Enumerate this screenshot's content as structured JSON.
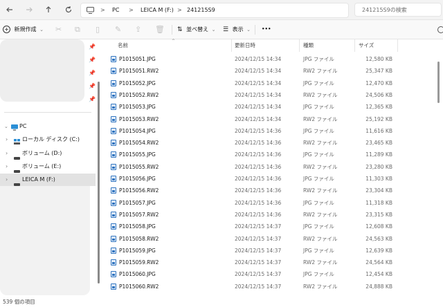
{
  "address": {
    "back_icon": "arrow-left-icon",
    "forward_icon": "arrow-right-icon",
    "up_icon": "arrow-up-icon",
    "refresh_icon": "refresh-icon",
    "path": [
      "PC",
      "LEICA M (F:)",
      "241215S9"
    ],
    "separator": ">",
    "search_placeholder": "241215S9の検索"
  },
  "toolbar": {
    "new_label": "新規作成",
    "sort_label": "並べ替え",
    "view_label": "表示",
    "more_label": "•••"
  },
  "sidebar": {
    "pc_label": "PC",
    "drives": [
      {
        "label": "ローカル ディスク (C:)",
        "icon": "local-disk-icon"
      },
      {
        "label": "ボリューム (D:)",
        "icon": "drive-icon"
      },
      {
        "label": "ボリューム (E:)",
        "icon": "drive-icon"
      },
      {
        "label": "LEICA M (F:)",
        "icon": "drive-icon",
        "selected": true
      }
    ]
  },
  "columns": {
    "name": "名前",
    "modified": "更新日時",
    "type": "種類",
    "size": "サイズ"
  },
  "files": [
    {
      "name": "P1015051.JPG",
      "date": "2024/12/15 14:34",
      "type": "JPG ファイル",
      "size": "12,580 KB"
    },
    {
      "name": "P1015051.RW2",
      "date": "2024/12/15 14:34",
      "type": "RW2 ファイル",
      "size": "25,347 KB"
    },
    {
      "name": "P1015052.JPG",
      "date": "2024/12/15 14:34",
      "type": "JPG ファイル",
      "size": "12,470 KB"
    },
    {
      "name": "P1015052.RW2",
      "date": "2024/12/15 14:34",
      "type": "RW2 ファイル",
      "size": "24,506 KB"
    },
    {
      "name": "P1015053.JPG",
      "date": "2024/12/15 14:34",
      "type": "JPG ファイル",
      "size": "12,365 KB"
    },
    {
      "name": "P1015053.RW2",
      "date": "2024/12/15 14:34",
      "type": "RW2 ファイル",
      "size": "25,192 KB"
    },
    {
      "name": "P1015054.JPG",
      "date": "2024/12/15 14:36",
      "type": "JPG ファイル",
      "size": "11,616 KB"
    },
    {
      "name": "P1015054.RW2",
      "date": "2024/12/15 14:36",
      "type": "RW2 ファイル",
      "size": "23,465 KB"
    },
    {
      "name": "P1015055.JPG",
      "date": "2024/12/15 14:36",
      "type": "JPG ファイル",
      "size": "11,289 KB"
    },
    {
      "name": "P1015055.RW2",
      "date": "2024/12/15 14:36",
      "type": "RW2 ファイル",
      "size": "23,280 KB"
    },
    {
      "name": "P1015056.JPG",
      "date": "2024/12/15 14:36",
      "type": "JPG ファイル",
      "size": "11,303 KB"
    },
    {
      "name": "P1015056.RW2",
      "date": "2024/12/15 14:36",
      "type": "RW2 ファイル",
      "size": "23,304 KB"
    },
    {
      "name": "P1015057.JPG",
      "date": "2024/12/15 14:36",
      "type": "JPG ファイル",
      "size": "11,318 KB"
    },
    {
      "name": "P1015057.RW2",
      "date": "2024/12/15 14:36",
      "type": "RW2 ファイル",
      "size": "23,315 KB"
    },
    {
      "name": "P1015058.JPG",
      "date": "2024/12/15 14:37",
      "type": "JPG ファイル",
      "size": "12,608 KB"
    },
    {
      "name": "P1015058.RW2",
      "date": "2024/12/15 14:37",
      "type": "RW2 ファイル",
      "size": "24,563 KB"
    },
    {
      "name": "P1015059.JPG",
      "date": "2024/12/15 14:37",
      "type": "JPG ファイル",
      "size": "12,639 KB"
    },
    {
      "name": "P1015059.RW2",
      "date": "2024/12/15 14:37",
      "type": "RW2 ファイル",
      "size": "24,564 KB"
    },
    {
      "name": "P1015060.JPG",
      "date": "2024/12/15 14:37",
      "type": "JPG ファイル",
      "size": "12,454 KB"
    },
    {
      "name": "P1015060.RW2",
      "date": "2024/12/15 14:37",
      "type": "RW2 ファイル",
      "size": "24,888 KB"
    }
  ],
  "status": {
    "item_count": "539 個の項目"
  },
  "colors": {
    "accent": "#2f74c0",
    "selected_bg": "#e2e2e2",
    "toolbar_bg": "#f9f9f9"
  }
}
